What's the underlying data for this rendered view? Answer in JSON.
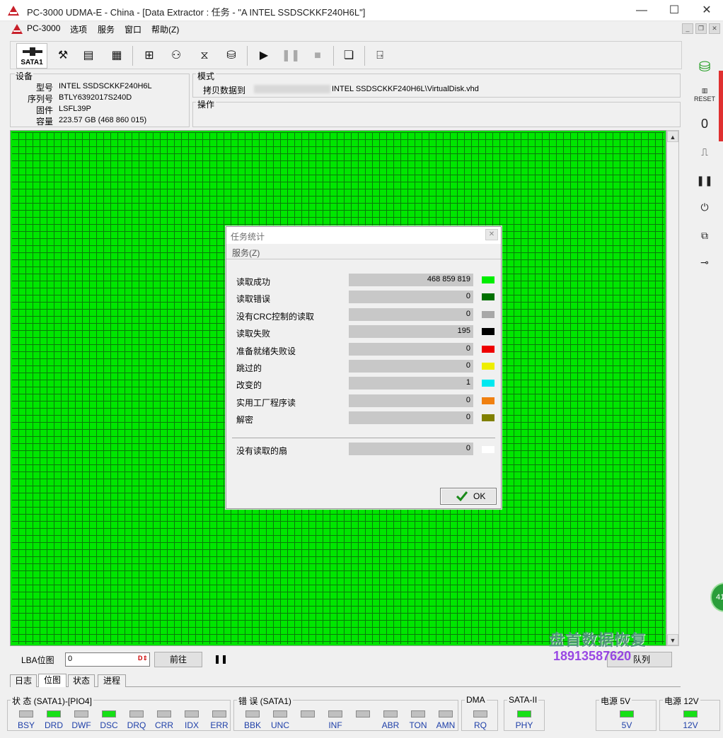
{
  "window": {
    "title": "PC-3000 UDMA-E - China - [Data Extractor : 任务 - \"A                    INTEL SSDSCKKF240H6L\"]",
    "minimize": "—",
    "maximize": "☐",
    "close": "✕"
  },
  "menu": [
    "PC-3000",
    "选项",
    "服务",
    "窗口",
    "帮助(Z)"
  ],
  "toolbar": {
    "sata_label": "SATA1"
  },
  "device": {
    "group_title": "设备",
    "model_label": "型号",
    "model": "INTEL SSDSCKKF240H6L",
    "serial_label": "序列号",
    "serial": "BTLY6392017S240D",
    "firmware_label": "固件",
    "firmware": "LSFL39P",
    "capacity_label": "容量",
    "capacity": "223.57 GB (468 860 015)"
  },
  "mode": {
    "group_title": "模式",
    "text_prefix": "拷贝数据到",
    "text_suffix": "INTEL SSDSCKKF240H6L\\VirtualDisk.vhd"
  },
  "operation": {
    "group_title": "操作"
  },
  "lba": {
    "label": "LBA位图",
    "value": "0",
    "go_button": "前往",
    "queue_button": "队列"
  },
  "tabs": [
    {
      "label": "日志",
      "active": false
    },
    {
      "label": "位图",
      "active": true
    },
    {
      "label": "状态",
      "active": false
    },
    {
      "label": "进程",
      "active": false
    }
  ],
  "dialog": {
    "title": "任务统计",
    "menu": "服务(Z)",
    "rows": [
      {
        "label": "读取成功",
        "value": "468 859 819",
        "color": "#00ee00"
      },
      {
        "label": "读取错误",
        "value": "0",
        "color": "#007000"
      },
      {
        "label": "没有CRC控制的读取",
        "value": "0",
        "color": "#a8a8a8"
      },
      {
        "label": "读取失败",
        "value": "195",
        "color": "#000000"
      },
      {
        "label": "准备就绪失败设",
        "value": "0",
        "color": "#ee0000"
      },
      {
        "label": "跳过的",
        "value": "0",
        "color": "#eeee00"
      },
      {
        "label": "改变的",
        "value": "1",
        "color": "#00e8f0"
      },
      {
        "label": "实用工厂程序读",
        "value": "0",
        "color": "#f08010"
      },
      {
        "label": "解密",
        "value": "0",
        "color": "#808000"
      }
    ],
    "unread_label": "没有读取的扇",
    "unread_value": "0",
    "unread_color": "#ffffff",
    "ok_label": "OK"
  },
  "status": {
    "state_title": "状 态 (SATA1)-[PIO4]",
    "state_leds": [
      {
        "label": "BSY",
        "on": false
      },
      {
        "label": "DRD",
        "on": true
      },
      {
        "label": "DWF",
        "on": false
      },
      {
        "label": "DSC",
        "on": true
      },
      {
        "label": "DRQ",
        "on": false
      },
      {
        "label": "CRR",
        "on": false
      },
      {
        "label": "IDX",
        "on": false
      },
      {
        "label": "ERR",
        "on": false
      }
    ],
    "error_title": "错 误 (SATA1)",
    "error_leds": [
      {
        "label": "BBK",
        "on": false
      },
      {
        "label": "UNC",
        "on": false
      },
      {
        "label": "",
        "on": false
      },
      {
        "label": "INF",
        "on": false
      },
      {
        "label": "",
        "on": false
      },
      {
        "label": "ABR",
        "on": false
      },
      {
        "label": "TON",
        "on": false
      },
      {
        "label": "AMN",
        "on": false
      }
    ],
    "dma_title": "DMA",
    "dma_label": "RQ",
    "sata_title": "SATA-II",
    "sata_label": "PHY",
    "p5_title": "电源 5V",
    "p5_label": "5V",
    "p12_title": "电源 12V",
    "p12_label": "12V"
  },
  "watermark": {
    "line1": "盘首数据恢复",
    "line2": "18913587620"
  },
  "side_badge": "41"
}
